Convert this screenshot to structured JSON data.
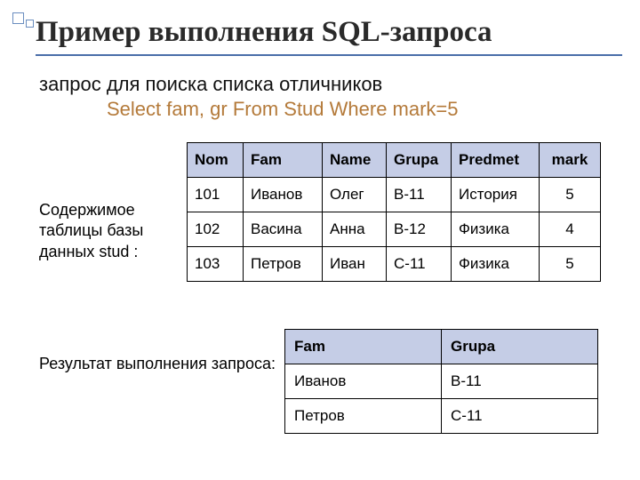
{
  "title": "Пример выполнения SQL-запроса",
  "subtitle": "запрос для поиска списка отличников",
  "sql": "Select fam, gr  From Stud  Where mark=5",
  "table_caption": "Содержимое таблицы базы данных stud :",
  "result_caption": "Результат выполнения запроса:",
  "table": {
    "headers": {
      "c0": "Nom",
      "c1": "Fam",
      "c2": "Name",
      "c3": "Grupa",
      "c4": "Predmet",
      "c5": "mark"
    },
    "rows": [
      {
        "c0": "101",
        "c1": "Иванов",
        "c2": "Олег",
        "c3": "В-11",
        "c4": "История",
        "c5": "5"
      },
      {
        "c0": "102",
        "c1": "Васина",
        "c2": "Анна",
        "c3": "В-12",
        "c4": "Физика",
        "c5": "4"
      },
      {
        "c0": "103",
        "c1": "Петров",
        "c2": "Иван",
        "c3": "С-11",
        "c4": "Физика",
        "c5": "5"
      }
    ]
  },
  "result": {
    "headers": {
      "c0": "Fam",
      "c1": "Grupa"
    },
    "rows": [
      {
        "c0": "Иванов",
        "c1": "В-11"
      },
      {
        "c0": "Петров",
        "c1": "С-11"
      }
    ]
  }
}
